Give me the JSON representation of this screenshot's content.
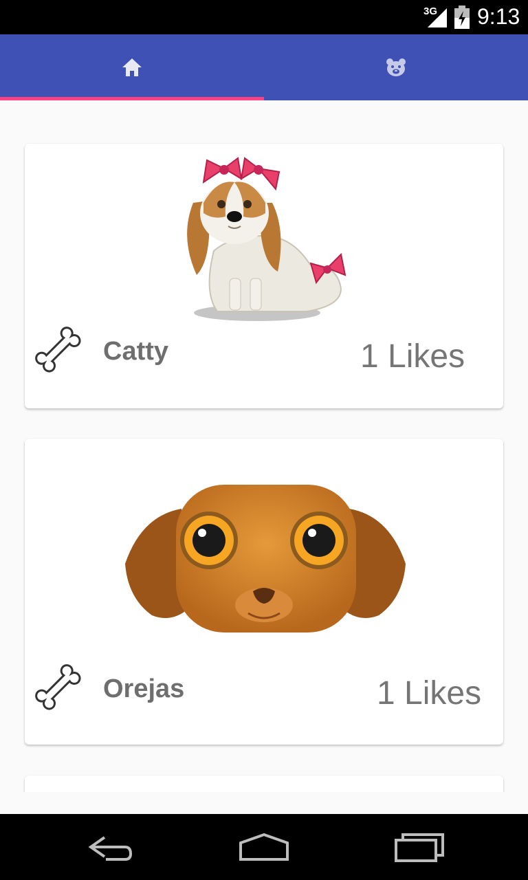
{
  "status_bar": {
    "network": "3G",
    "time": "9:13",
    "icons": [
      "signal-icon",
      "battery-icon"
    ]
  },
  "tabs": [
    {
      "icon": "home-icon",
      "selected": true
    },
    {
      "icon": "bear-face-icon",
      "selected": false
    }
  ],
  "colors": {
    "primary": "#3F51B5",
    "accent": "#FF4081",
    "background": "#FAFAFA",
    "card": "#FFFFFF",
    "text": "#757575"
  },
  "pets": [
    {
      "name": "Catty",
      "likes": "1 Likes",
      "image": "cavalier-puppy-with-pink-bows",
      "action_icon": "bone-icon"
    },
    {
      "name": "Orejas",
      "likes": "1 Likes",
      "image": "brown-dog-face",
      "action_icon": "bone-icon"
    }
  ],
  "nav_bar": [
    "back-icon",
    "home-icon",
    "recents-icon"
  ]
}
